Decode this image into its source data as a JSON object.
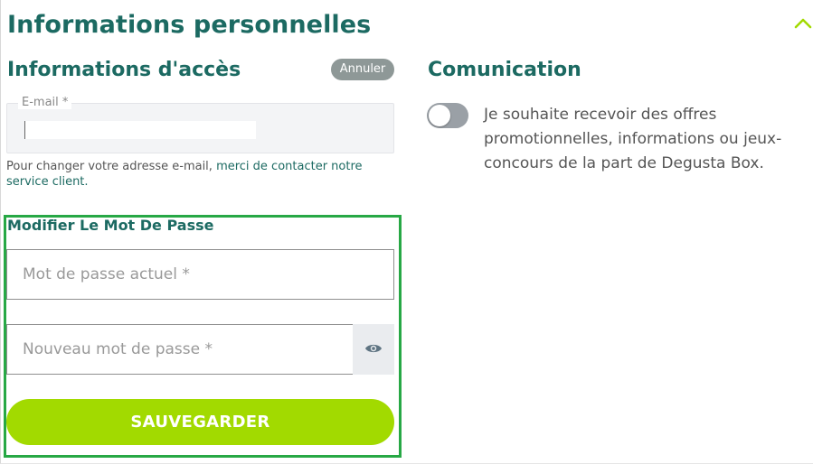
{
  "header": {
    "title": "Informations personnelles",
    "collapse_icon": "chevron-up-icon"
  },
  "access": {
    "title": "Informations d'accès",
    "cancel_label": "Annuler",
    "email_label": "E-mail *",
    "email_value": "",
    "helper_text": "Pour changer votre adresse e-mail, ",
    "helper_link": "merci de contacter notre service client."
  },
  "password": {
    "title": "Modifier Le Mot De Passe",
    "current_placeholder": "Mot de passe actuel *",
    "new_placeholder": "Nouveau mot de passe *",
    "eye_icon": "eye-icon",
    "save_label": "SAUVEGARDER"
  },
  "communication": {
    "title": "Comunication",
    "consent_text": "Je souhaite recevoir des offres promotionnelles, informations ou jeux-concours de la part de Degusta Box.",
    "toggle_on": false
  },
  "colors": {
    "brand_teal": "#1c6a62",
    "accent_green": "#a2da00",
    "highlight_frame": "#27a845",
    "muted_grey": "#8e9897"
  }
}
